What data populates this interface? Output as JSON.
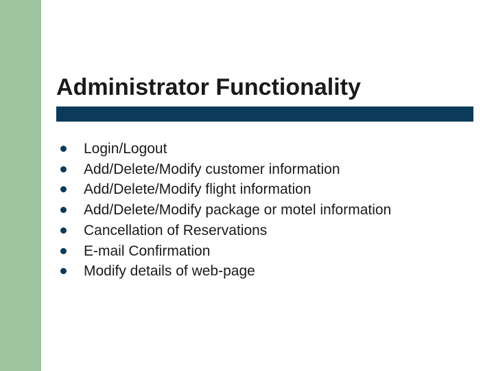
{
  "title": "Administrator Functionality",
  "bullets": [
    "Login/Logout",
    "Add/Delete/Modify customer information",
    "Add/Delete/Modify flight information",
    "Add/Delete/Modify package or motel information",
    "Cancellation of Reservations",
    "E-mail Confirmation",
    "Modify details of web-page"
  ],
  "colors": {
    "left_band": "#9dc49d",
    "bar": "#0b3a5a"
  }
}
